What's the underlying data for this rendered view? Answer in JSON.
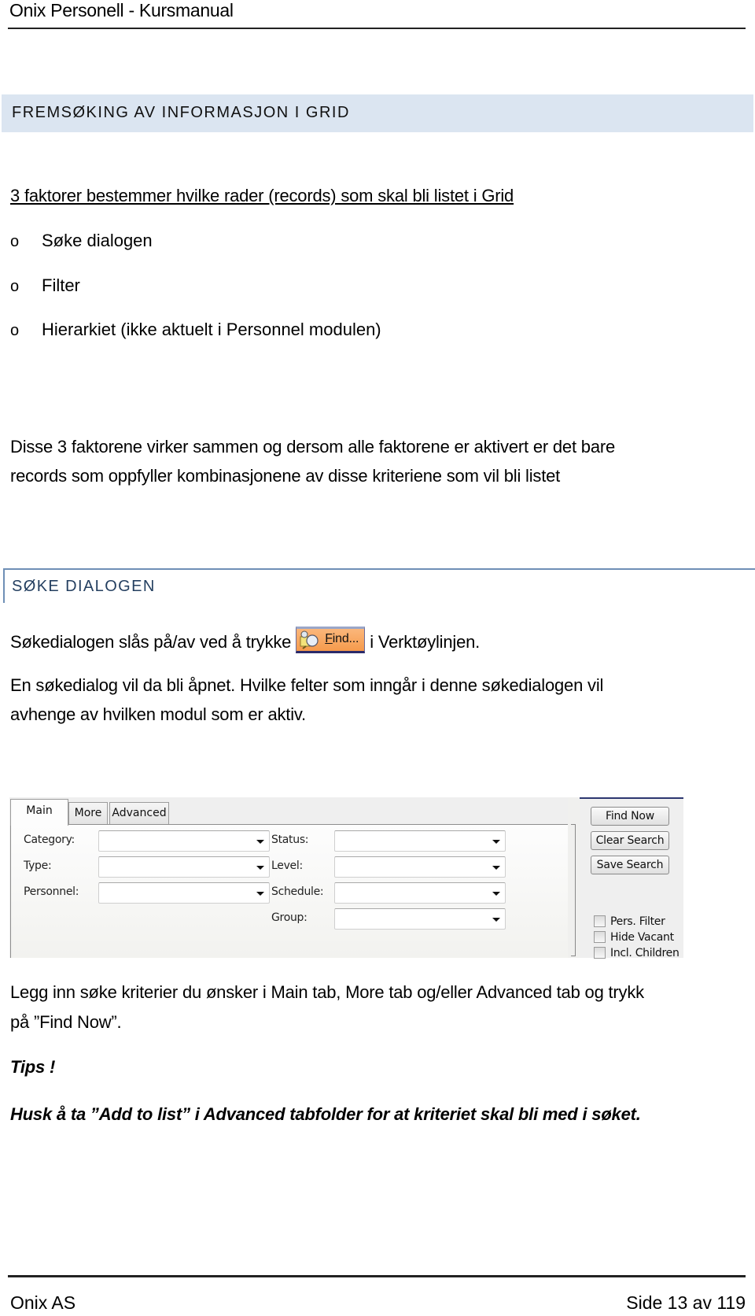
{
  "header": {
    "title": "Onix Personell - Kursmanual"
  },
  "section": {
    "title": "FREMSØKING AV INFORMASJON I GRID"
  },
  "intro": {
    "heading": "3 faktorer bestemmer hvilke rader (records) som skal bli listet i Grid",
    "bullet_glyph": "o",
    "bullets": [
      {
        "label": "Søke dialogen"
      },
      {
        "label": "Filter"
      },
      {
        "label": "Hierarkiet (ikke aktuelt i Personnel modulen)"
      }
    ],
    "paragraph_line1": "Disse 3 faktorene virker sammen og dersom alle faktorene er aktivert er det bare",
    "paragraph_line2": "records som oppfyller kombinasjonene av disse kriteriene som vil bli listet"
  },
  "subsection": {
    "title": "SØKE DIALOGEN",
    "toggle_text_before": "Søkedialogen slås på/av ved å trykke",
    "toggle_text_after": "i Verktøylinjen.",
    "find_button": {
      "icon": "find-search-icon",
      "label_accel": "F",
      "label_rest": "ind...",
      "accent": "#f7a25a"
    },
    "open_line1": "En søkedialog vil da bli åpnet. Hvilke felter som inngår i denne søkedialogen vil",
    "open_line2": "avhenge av hvilken modul som er aktiv."
  },
  "dialog": {
    "tabs": [
      {
        "label": "Main",
        "active": true
      },
      {
        "label": "More",
        "active": false
      },
      {
        "label": "Advanced",
        "active": false
      }
    ],
    "left_fields": [
      {
        "label": "Category:",
        "value": ""
      },
      {
        "label": "Type:",
        "value": ""
      },
      {
        "label": "Personnel:",
        "value": ""
      }
    ],
    "right_fields": [
      {
        "label": "Status:",
        "value": ""
      },
      {
        "label": "Level:",
        "value": ""
      },
      {
        "label": "Schedule:",
        "value": ""
      },
      {
        "label": "Group:",
        "value": ""
      }
    ],
    "buttons": [
      {
        "label": "Find Now"
      },
      {
        "label": "Clear Search"
      },
      {
        "label": "Save Search"
      }
    ],
    "checkboxes": [
      {
        "label": "Pers. Filter",
        "checked": false
      },
      {
        "label": "Hide Vacant",
        "checked": false
      },
      {
        "label": "Incl. Children",
        "checked": false
      }
    ]
  },
  "instructions": {
    "line1": "Legg inn søke kriterier du ønsker i Main tab, More tab og/eller Advanced tab og trykk",
    "line2": "på ”Find Now”.",
    "tips_label": "Tips !",
    "tips_text": "Husk å ta ”Add to list” i Advanced tabfolder for at kriteriet skal bli med i søket."
  },
  "footer": {
    "company": "Onix AS",
    "page": "Side 13 av 119"
  },
  "colors": {
    "section_band": "#dbe5f1",
    "subheading": "#243f60",
    "subheading_rule": "#6f8fb6"
  }
}
